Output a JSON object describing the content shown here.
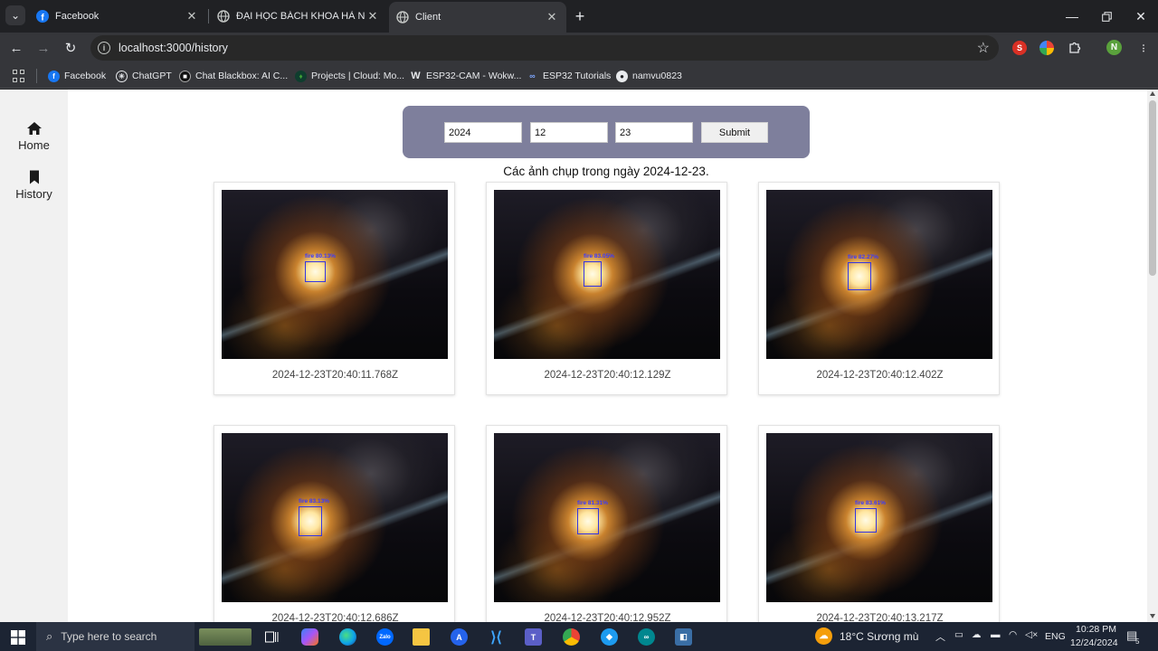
{
  "browser": {
    "tabs": [
      {
        "title": "Facebook",
        "favicon": "facebook-icon",
        "active": false
      },
      {
        "title": "ĐẠI HỌC BÁCH KHOA HÀ NỘI",
        "favicon": "globe-icon",
        "active": false
      },
      {
        "title": "Client",
        "favicon": "globe-icon",
        "active": true
      }
    ],
    "new_tab_label": "+",
    "url": "localhost:3000/history",
    "profile_initial": "N",
    "extension_badge": "S"
  },
  "bookmarks": [
    {
      "label": "Facebook",
      "icon": "facebook-icon"
    },
    {
      "label": "ChatGPT",
      "icon": "chatgpt-icon"
    },
    {
      "label": "Chat Blackbox: AI C...",
      "icon": "blackbox-icon"
    },
    {
      "label": "Projects | Cloud: Mo...",
      "icon": "mongodb-icon"
    },
    {
      "label": "ESP32-CAM - Wokw...",
      "icon": "wokwi-icon"
    },
    {
      "label": "ESP32 Tutorials",
      "icon": "esp32-icon"
    },
    {
      "label": "namvu0823",
      "icon": "github-icon"
    }
  ],
  "sidebar": {
    "items": [
      {
        "label": "Home",
        "icon": "home-icon"
      },
      {
        "label": "History",
        "icon": "bookmark-icon"
      }
    ]
  },
  "filter": {
    "year": "2024",
    "month": "12",
    "day": "23",
    "submit_label": "Submit"
  },
  "caption": "Các ảnh chụp trong ngày 2024-12-23.",
  "captures": [
    {
      "timestamp": "2024-12-23T20:40:11.768Z",
      "detection": "fire 80.13%"
    },
    {
      "timestamp": "2024-12-23T20:40:12.129Z",
      "detection": "fire 83.05%"
    },
    {
      "timestamp": "2024-12-23T20:40:12.402Z",
      "detection": "fire 82.27%"
    },
    {
      "timestamp": "2024-12-23T20:40:12.686Z",
      "detection": "fire 83.13%"
    },
    {
      "timestamp": "2024-12-23T20:40:12.952Z",
      "detection": "fire 81.31%"
    },
    {
      "timestamp": "2024-12-23T20:40:13.217Z",
      "detection": "fire 83.61%"
    }
  ],
  "taskbar": {
    "search_placeholder": "Type here to search",
    "weather": "18°C  Sương mù",
    "language": "ENG",
    "time": "10:28 PM",
    "date": "12/24/2024",
    "notification_count": "5"
  },
  "colors": {
    "filter_bar": "#7e7f9c",
    "detection_box": "#3535e0",
    "sidebar_bg": "#f1f1f1"
  }
}
